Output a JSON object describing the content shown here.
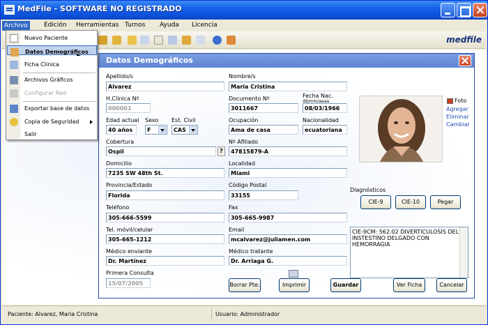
{
  "app": {
    "title": "MedFile - SOFTWARE NO REGISTRADO",
    "brand": "medfile"
  },
  "menubar": [
    "Archivo",
    "Edición",
    "Herramientas",
    "Turnos",
    "Ayuda",
    "Licencia"
  ],
  "file_menu": [
    {
      "label": "Nuevo Paciente",
      "icon": "new-patient-icon",
      "state": "normal"
    },
    {
      "label": "Datos Demográficos",
      "icon": "demographics-icon",
      "state": "selected"
    },
    {
      "label": "Ficha Clinica",
      "icon": "clinical-file-icon",
      "state": "normal"
    },
    {
      "label": "Archivos Gráficos",
      "icon": "graphic-files-icon",
      "state": "normal"
    },
    {
      "label": "Configurar Red",
      "icon": "network-config-icon",
      "state": "disabled"
    },
    {
      "label": "Exportar base de datos",
      "icon": "export-db-icon",
      "state": "normal"
    },
    {
      "label": "Copia de Seguridad",
      "icon": "backup-icon",
      "state": "submenu"
    },
    {
      "label": "Salir",
      "icon": "",
      "state": "normal"
    }
  ],
  "dialog": {
    "title": "Datos Demográficos",
    "labels": {
      "apellido": "Apellido/s",
      "nombre": "Nombre/s",
      "hclinica": "H.Clinica Nº",
      "documento": "Documento Nº",
      "fechanac": "Fecha Nac.",
      "fechafmt": "dd/mm/aaaa",
      "edad": "Edad actual",
      "sexo": "Sexo",
      "estcivil": "Est. Civil",
      "ocupacion": "Ocupación",
      "nacionalidad": "Nacionalidad",
      "cobertura": "Cobertura",
      "afiliado": "Nº Afiliado",
      "domicilio": "Domicilio",
      "localidad": "Localidad",
      "provincia": "Provincia/Estado",
      "cp": "Código Postal",
      "telefono": "Teléfono",
      "fax": "Fax",
      "movil": "Tel. móvil/celular",
      "email": "Email",
      "medenv": "Médico enviante",
      "medtrat": "Médico tratante",
      "primera": "Primera Consulta",
      "diagnosticos": "Diagnósticos"
    },
    "values": {
      "apellido": "Alvarez",
      "nombre": "Maria Cristina",
      "hclinica": "000001",
      "documento": "3011667",
      "fechanac": "08/03/1966",
      "edad": "40 años",
      "sexo": "F",
      "estcivil": "CAS",
      "ocupacion": "Ama de casa",
      "nacionalidad": "ecuatoriana",
      "cobertura": "Ospil",
      "afiliado": "47815879-A",
      "domicilio": "7235 SW 48th St.",
      "localidad": "Miami",
      "provincia": "Florida",
      "cp": "33155",
      "telefono": "305-666-5599",
      "fax": "305-665-9987",
      "movil": "305-665-1212",
      "email": "mcalvarez@juliamen.com",
      "medenv": "Dr. Martínez",
      "medtrat": "Dr. Arriaga G.",
      "primera": "15/07/2005"
    },
    "photo_links": [
      "Foto",
      "Agregar",
      "Eliminar",
      "Cambiar"
    ],
    "question": "?",
    "diag_buttons": [
      "CIE-9",
      "CIE-10",
      "Pegar"
    ],
    "diagnosis_text": "CIE-9CM: 562.02 DIVERTICULOSIS DEL INSTESTINO DELGADO CON HEMORRAGIA",
    "buttons": {
      "borrar": "Borrar Pte.",
      "imprimir": "Imprimir",
      "guardar": "Guardar",
      "verficha": "Ver Ficha",
      "cancelar": "Cancelar"
    }
  },
  "status": {
    "patient": "Paciente: Alvarez, Maria Cristina",
    "user": "Usuario: Administrador"
  },
  "colors": {
    "titlebar": "#0a4fd6",
    "dialog_title": "#6b8ed6",
    "menu_selected": "#c1d2ee",
    "link": "#1c4fb5"
  }
}
